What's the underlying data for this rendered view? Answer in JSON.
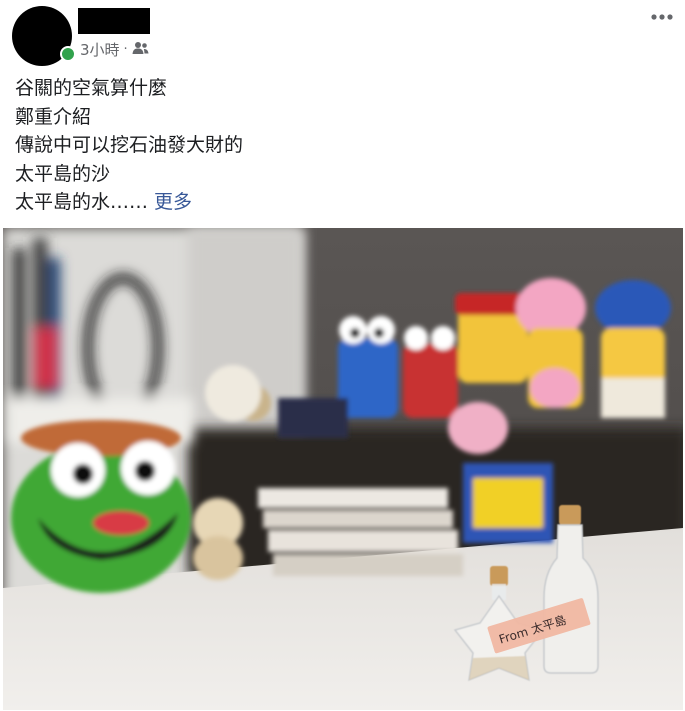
{
  "post": {
    "timestamp": "3小時",
    "separator": "·",
    "privacy_icon": "friends-icon",
    "more_icon": "more-horizontal-icon",
    "lines": [
      "谷關的空氣算什麼",
      "鄭重介紹",
      "傳說中可以挖石油發大財的",
      "太平島的沙",
      "太平島的水……"
    ],
    "see_more": "更多",
    "photo_label": "From 太平島"
  },
  "colors": {
    "text": "#1c1e21",
    "meta": "#65676b",
    "link": "#385898",
    "online": "#31a24c"
  }
}
